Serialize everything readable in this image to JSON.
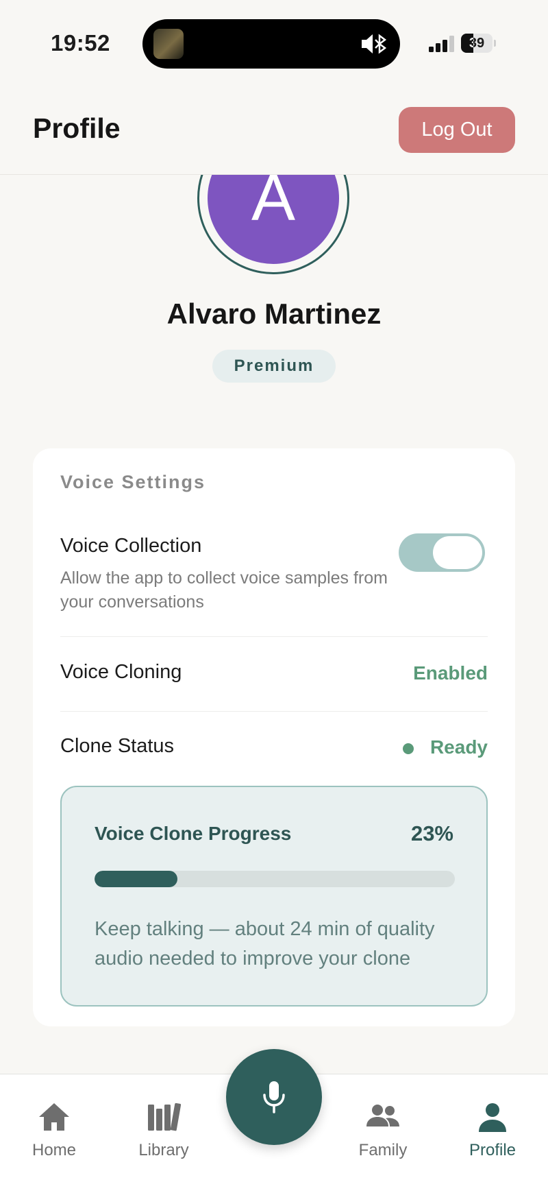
{
  "status_bar": {
    "time": "19:52",
    "battery": "39"
  },
  "header": {
    "title": "Profile",
    "logout_label": "Log Out"
  },
  "profile": {
    "avatar_initial": "A",
    "name": "Alvaro Martinez",
    "plan_badge": "Premium"
  },
  "voice_settings": {
    "title": "Voice Settings",
    "voice_collection": {
      "label": "Voice Collection",
      "description": "Allow the app to collect voice samples from your conversations",
      "enabled": true
    },
    "voice_cloning": {
      "label": "Voice Cloning",
      "value": "Enabled"
    },
    "clone_status": {
      "label": "Clone Status",
      "value": "Ready"
    },
    "progress": {
      "title": "Voice Clone Progress",
      "percent_label": "23%",
      "percent": 23,
      "note": "Keep talking — about 24 min of quality audio needed to improve your clone"
    }
  },
  "tabbar": {
    "tabs": [
      {
        "label": "Home",
        "icon": "home-icon"
      },
      {
        "label": "Library",
        "icon": "library-icon"
      },
      {
        "label": "Family",
        "icon": "family-icon"
      },
      {
        "label": "Profile",
        "icon": "profile-icon",
        "active": true
      }
    ],
    "center_action_icon": "microphone-icon"
  },
  "colors": {
    "accent": "#2f5f5c",
    "logout": "#cd7979",
    "avatar": "#7e55c0",
    "status_green": "#5a9a79"
  }
}
